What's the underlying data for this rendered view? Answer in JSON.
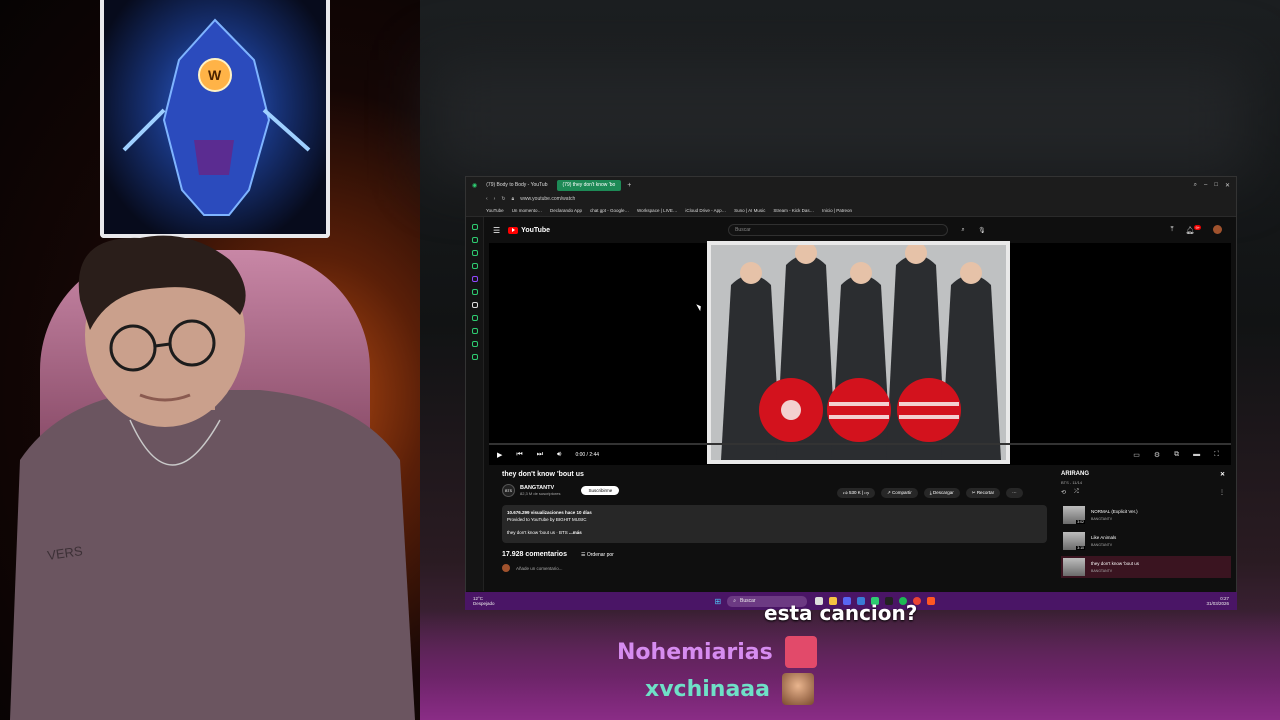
{
  "browser": {
    "tabs": [
      {
        "label": "(79) Body to Body - YouTub",
        "active": false
      },
      {
        "label": "(79) they don't know 'bo",
        "active": true
      }
    ],
    "url": "www.youtube.com/watch",
    "bookmarks": [
      "YouTube",
      "Un momento…",
      "Declarando App",
      "chat gpt - Google…",
      "Workspace | LIVE…",
      "iCloud Drive - App…",
      "Suno | AI Music",
      "Stream - Kick Das…",
      "Inicio | Patreon"
    ]
  },
  "youtube": {
    "logo": "YouTube",
    "search_placeholder": "Buscar",
    "notification_count": "9+",
    "player": {
      "time": "0:00 / 2:44",
      "progress": 0.0
    },
    "video_title": "they don't know 'bout us",
    "channel": {
      "name": "BANGTANTV",
      "subscribers": "82,3 M de suscriptores",
      "logo_text": "BTS"
    },
    "subscribe_label": "Suscribirme",
    "actions": {
      "likes": "530 K",
      "share": "Compartir",
      "download": "Descargar",
      "clip": "Recortar"
    },
    "description": {
      "stats": "10.676.299 visualizaciones  hace 10 días",
      "line2": "Provided to YouTube by BIGHIT MUSIC",
      "line3": "they don't know 'bout us · BTS",
      "more": "...más"
    },
    "comments": {
      "count": "17.928 comentarios",
      "sort": "Ordenar por",
      "add_placeholder": "Añade un comentario..."
    },
    "playlist": {
      "title": "ARIRANG",
      "subtitle": "BTS - 11/14",
      "items": [
        {
          "title": "NORMAL (Explicit Ver.)",
          "channel": "BANGTANTV",
          "duration": "3:02",
          "current": false
        },
        {
          "title": "Like Animals",
          "channel": "BANGTANTV",
          "duration": "3:10",
          "current": false
        },
        {
          "title": "they don't know 'bout us",
          "channel": "BANGTANTV",
          "duration": "",
          "current": true
        }
      ]
    }
  },
  "taskbar": {
    "weather_temp": "12°C",
    "weather_desc": "Despejado",
    "search_label": "Buscar",
    "time": "0:27",
    "date": "31/03/2026"
  },
  "overlay": {
    "question_text": "esta cancion?",
    "chat": [
      {
        "user": "Nohemiarias",
        "color": "#d68cf0"
      },
      {
        "user": "xvchinaaa",
        "color": "#6fe0c7"
      }
    ]
  },
  "colors": {
    "youtube_red": "#ff0000",
    "active_tab": "#1d8a56",
    "taskbar": "#4a1566"
  }
}
